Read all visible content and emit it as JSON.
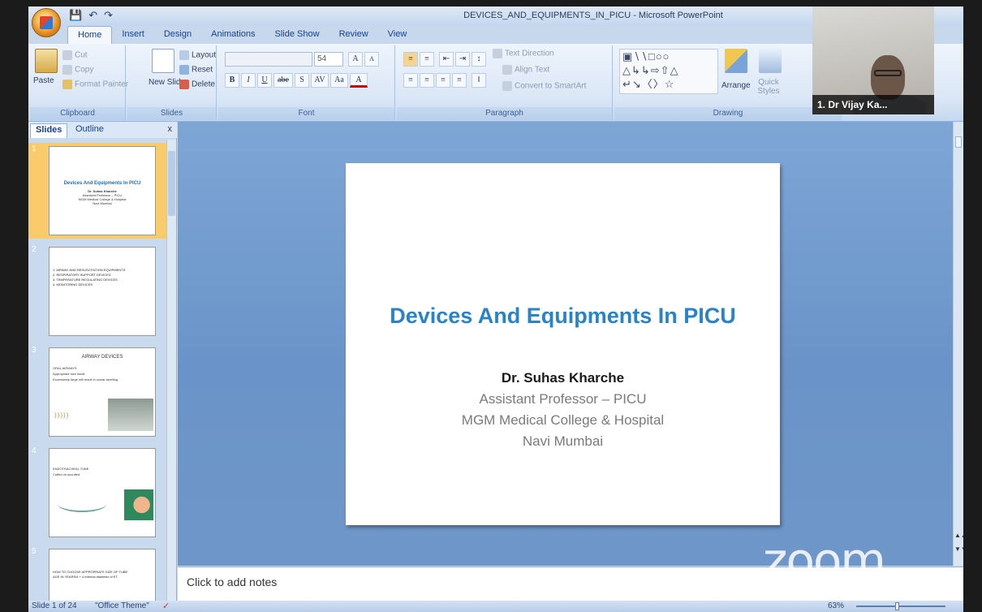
{
  "window": {
    "title": "DEVICES_AND_EQUIPMENTS_IN_PICU - Microsoft PowerPoint"
  },
  "quick_access": [
    "save-icon",
    "undo-icon",
    "redo-icon"
  ],
  "tabs": [
    "Home",
    "Insert",
    "Design",
    "Animations",
    "Slide Show",
    "Review",
    "View"
  ],
  "ribbon": {
    "clipboard": {
      "paste": "Paste",
      "cut": "Cut",
      "copy": "Copy",
      "format_painter": "Format Painter",
      "label": "Clipboard"
    },
    "slides": {
      "new_slide": "New Slide",
      "layout": "Layout",
      "reset": "Reset",
      "delete": "Delete",
      "label": "Slides"
    },
    "font": {
      "size": "54",
      "label": "Font",
      "bold": "B",
      "italic": "I",
      "underline": "U",
      "strike": "abe",
      "shadow": "S",
      "spacing": "AV",
      "case": "Aa",
      "grow": "A",
      "shrink": "A"
    },
    "paragraph": {
      "text_direction": "Text Direction",
      "align_text": "Align Text",
      "smartart": "Convert to SmartArt",
      "label": "Paragraph"
    },
    "drawing": {
      "arrange": "Arrange",
      "quick_styles": "Quick Styles",
      "label": "Drawing"
    }
  },
  "webcam": {
    "participant": "1. Dr Vijay Ka..."
  },
  "left_pane": {
    "tabs": [
      "Slides",
      "Outline"
    ],
    "close": "x",
    "thumbnails": [
      {
        "num": "1",
        "title": "Devices And Equipments In PICU",
        "sub": [
          "Dr. Suhas Kharche",
          "Assistant Professor – PICU",
          "MGM Medical College & Hospital",
          "Navi Mumbai"
        ]
      },
      {
        "num": "2",
        "bullets": [
          "1. AIRWAY AND RESUSCITATION EQUIPMENTS",
          "2. RESPIRATORY SUPPORT DEVICES",
          "3. TEMPERATURE REGULATING DEVICES",
          "4. MONITORING DEVICES"
        ]
      },
      {
        "num": "3",
        "heading": "AIRWAY DEVICES",
        "lines": [
          "ORAL AIRWAYS",
          "Appropriate size small",
          "Excessively large will result in ocular swelling"
        ]
      },
      {
        "num": "4",
        "heading": "ENDOTRACHEAL TUBE",
        "lines": [
          "Cuffed vs uncuffed"
        ]
      },
      {
        "num": "5",
        "bullets": [
          "HOW TO CHOOSE APPROPRIATE SIZE OF TUBE",
          "AGE IN YEARS/4 + 4 internal diameter of ET"
        ]
      }
    ]
  },
  "slide": {
    "title": "Devices And Equipments In PICU",
    "presenter": "Dr. Suhas Kharche",
    "role": "Assistant Professor – PICU",
    "institution": "MGM Medical College & Hospital",
    "location": "Navi Mumbai"
  },
  "notes": {
    "placeholder": "Click to add notes"
  },
  "watermark": "zoom",
  "status": {
    "slide": "Slide 1 of 24",
    "theme": "\"Office Theme\"",
    "zoom": "63%"
  }
}
